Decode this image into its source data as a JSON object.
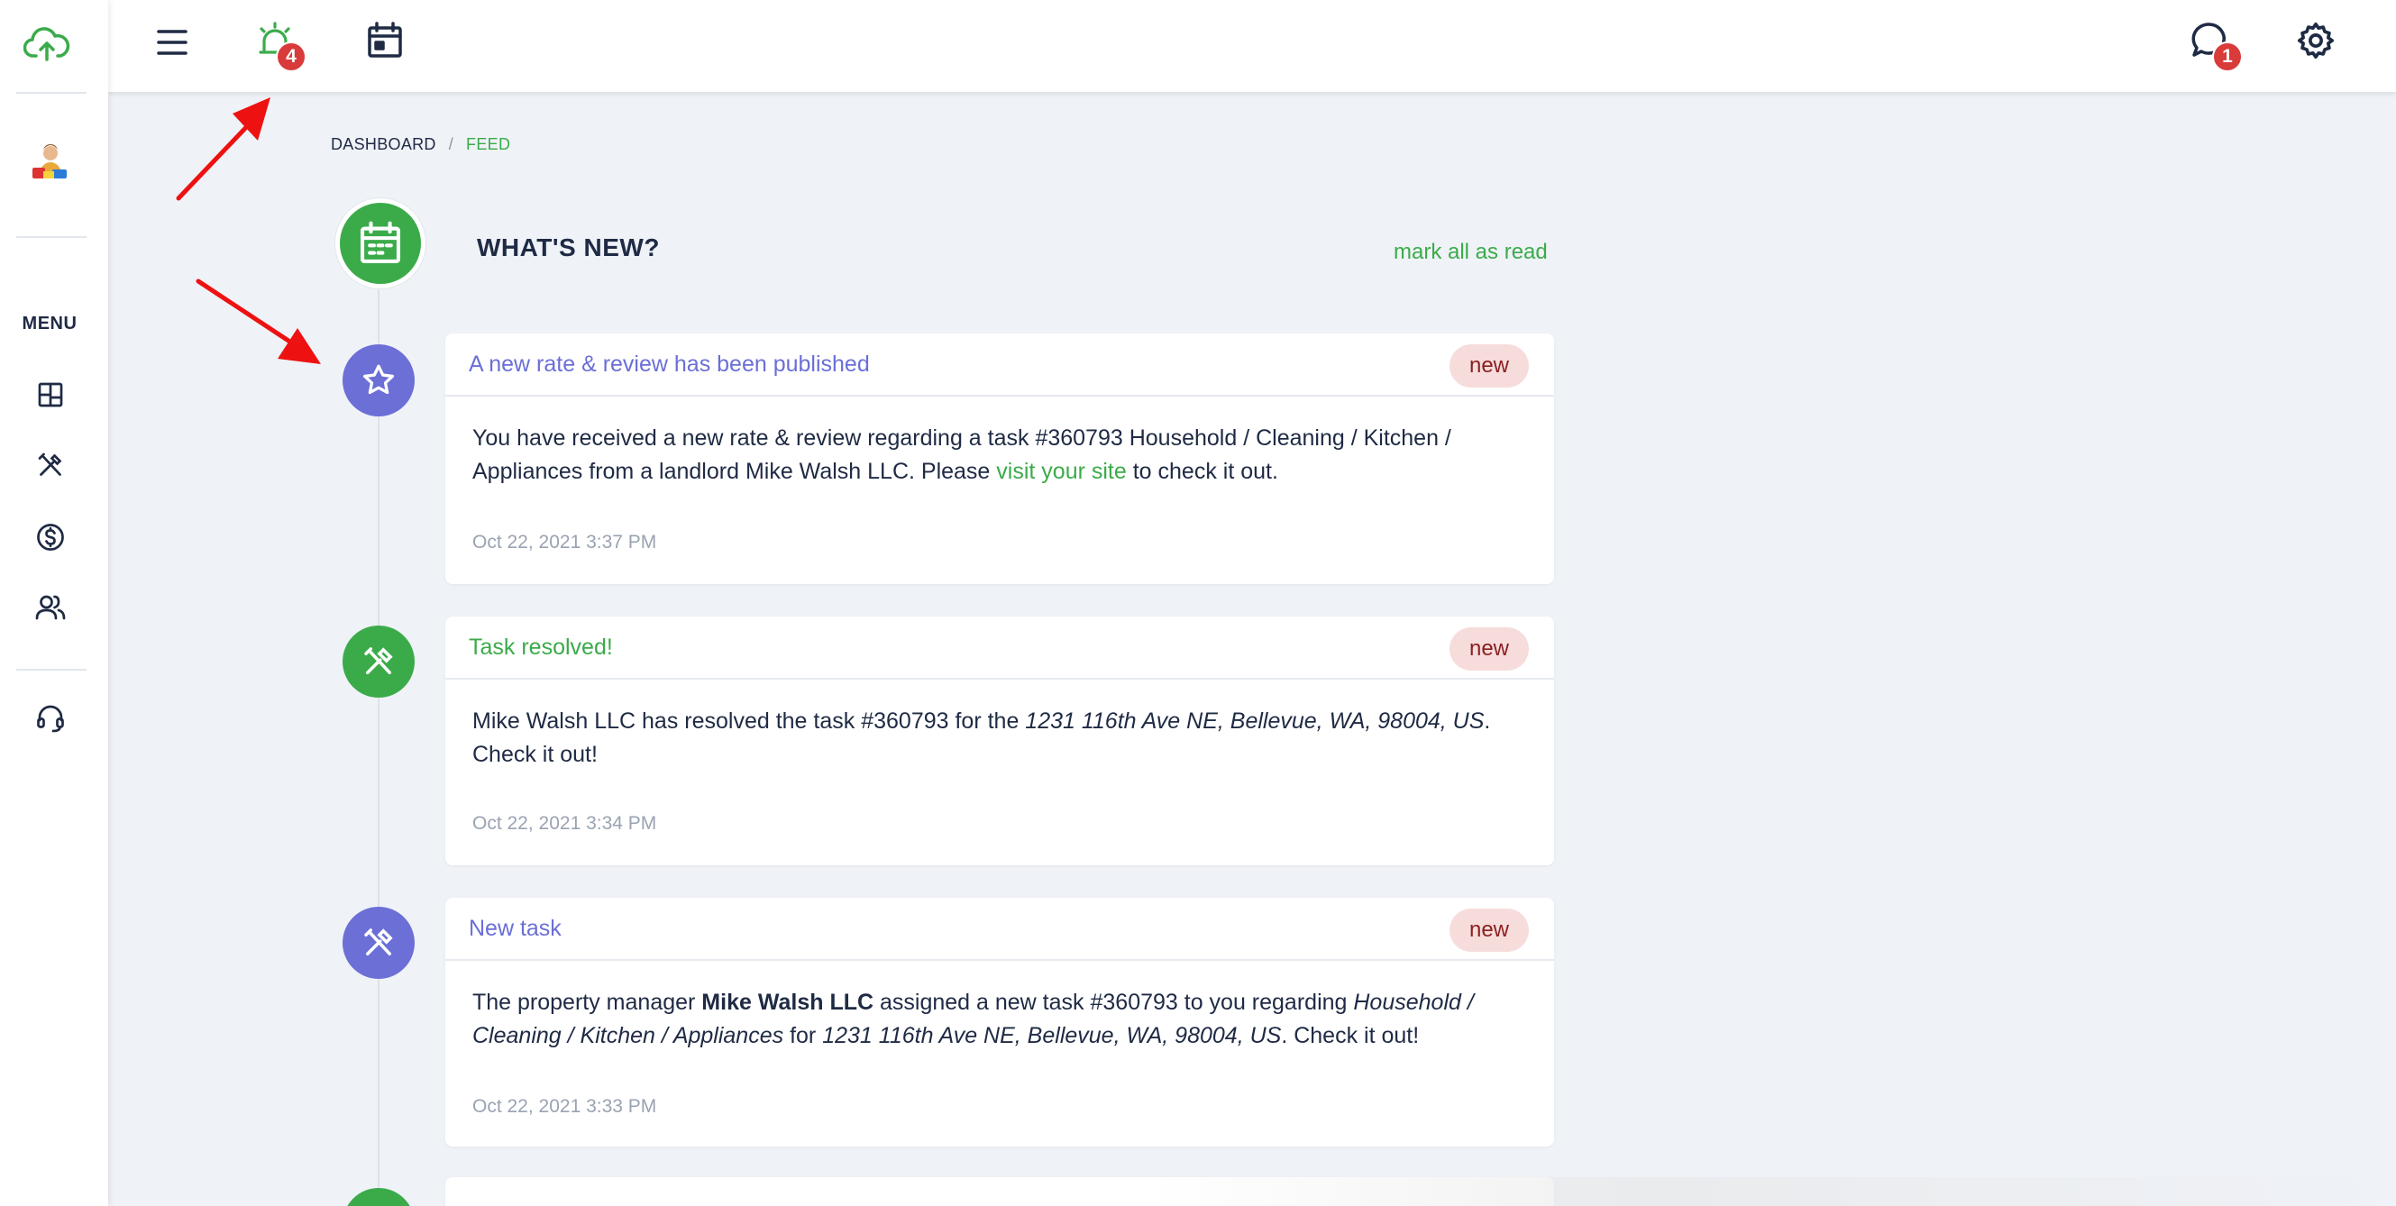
{
  "colors": {
    "green": "#3bab4a",
    "purple": "#6b6fd6",
    "red_badge": "#d93a3a",
    "new_bg": "#f7dcdc"
  },
  "sidebar": {
    "menu_label": "MENU",
    "icons": [
      "cloud-upload-icon",
      "dashboard-grid-icon",
      "tools-icon",
      "dollar-icon",
      "users-icon",
      "headset-icon"
    ]
  },
  "topbar": {
    "alerts_badge": "4",
    "messages_badge": "1"
  },
  "breadcrumb": {
    "home": "DASHBOARD",
    "separator": "/",
    "current": "FEED"
  },
  "feed": {
    "title": "WHAT'S NEW?",
    "mark_all": "mark all as read",
    "items": [
      {
        "title": "A new rate & review has been published",
        "badge": "new",
        "body_part1": "You have received a new rate & review regarding a task #360793 Household / Cleaning / Kitchen / Appliances from a landlord Mike Walsh LLC. Please ",
        "body_link": "visit your site",
        "body_part2": " to check it out.",
        "time": "Oct 22, 2021 3:37 PM"
      },
      {
        "title": "Task resolved!",
        "badge": "new",
        "body_part1": "Mike Walsh LLC has resolved the task #360793 for the ",
        "body_italic": "1231 116th Ave NE, Bellevue, WA, 98004, US",
        "body_part2": ". Check it out!",
        "time": "Oct 22, 2021 3:34 PM"
      },
      {
        "title": "New task",
        "badge": "new",
        "body_part1": "The property manager ",
        "body_bold": "Mike Walsh LLC",
        "body_part2": " assigned a new task #360793 to you regarding ",
        "body_italic1": "Household / Cleaning / Kitchen / Appliances",
        "body_part3": " for ",
        "body_italic2": "1231 116th Ave NE, Bellevue, WA, 98004, US",
        "body_part4": ". Check it out!",
        "time": "Oct 22, 2021 3:33 PM"
      }
    ]
  }
}
